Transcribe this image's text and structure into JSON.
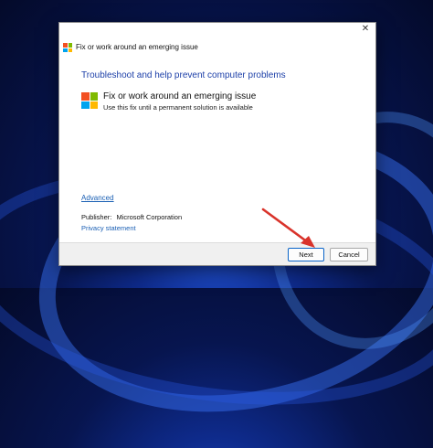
{
  "window": {
    "title": "Fix or work around an emerging issue",
    "close_glyph": "✕"
  },
  "main": {
    "heading": "Troubleshoot and help prevent computer problems",
    "item_title": "Fix or work around an emerging issue",
    "item_subtitle": "Use this fix until a permanent solution is available",
    "advanced_link": "Advanced",
    "publisher_label": "Publisher:",
    "publisher_name": "Microsoft Corporation",
    "privacy_link": "Privacy statement"
  },
  "footer": {
    "next_label": "Next",
    "cancel_label": "Cancel"
  },
  "colors": {
    "ms_red": "#f25022",
    "ms_green": "#7fba00",
    "ms_blue": "#00a4ef",
    "ms_yellow": "#ffb900",
    "heading_blue": "#1c3fa8",
    "link_blue": "#1a5fb4",
    "arrow_red": "#d9332b"
  },
  "icons": [
    "microsoft-logo-icon",
    "close-icon",
    "red-arrow-annotation"
  ]
}
